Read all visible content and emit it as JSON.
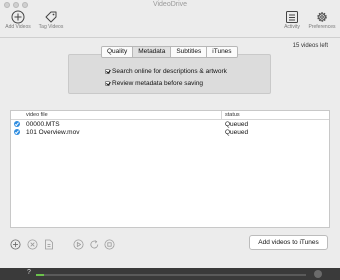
{
  "window": {
    "title": "VideoDrive"
  },
  "toolbar": {
    "add_videos_label": "Add Videos",
    "tag_videos_label": "Tag Videos",
    "activity_label": "Activity",
    "preferences_label": "Preferences"
  },
  "status": {
    "videos_left": "15 videos left"
  },
  "tabs": [
    {
      "label": "Quality",
      "active": false
    },
    {
      "label": "Metadata",
      "active": true
    },
    {
      "label": "Subtitles",
      "active": false
    },
    {
      "label": "iTunes",
      "active": false
    }
  ],
  "metadata_options": [
    {
      "label": "Search online for descriptions & artwork",
      "checked": true
    },
    {
      "label": "Review metadata before saving",
      "checked": true
    }
  ],
  "table": {
    "columns": {
      "file": "video file",
      "status": "status"
    },
    "rows": [
      {
        "file": "00000.MTS",
        "status": "Queued",
        "checked": true
      },
      {
        "file": "101 Overview.mov",
        "status": "Queued",
        "checked": true
      }
    ]
  },
  "actions": {
    "add_to_itunes": "Add videos to iTunes"
  },
  "progress": {
    "marker": "?",
    "fraction": 0.03
  },
  "colors": {
    "accent": "#2f8de0",
    "progress": "#6bc24b"
  }
}
